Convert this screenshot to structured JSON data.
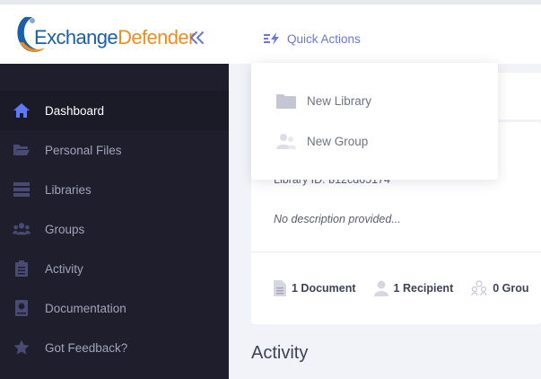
{
  "header": {
    "logo_part1": "Exchange",
    "logo_part2": "Defender",
    "quick_actions_label": "Quick Actions"
  },
  "dropdown": {
    "items": [
      {
        "label": "New Library",
        "icon": "folder-icon"
      },
      {
        "label": "New Group",
        "icon": "users-icon"
      }
    ]
  },
  "sidebar": {
    "items": [
      {
        "label": "Dashboard",
        "icon": "home-icon",
        "active": true
      },
      {
        "label": "Personal Files",
        "icon": "folder-open-icon"
      },
      {
        "label": "Libraries",
        "icon": "server-icon"
      },
      {
        "label": "Groups",
        "icon": "users-icon"
      },
      {
        "label": "Activity",
        "icon": "clipboard-icon"
      },
      {
        "label": "Documentation",
        "icon": "book-icon"
      },
      {
        "label": "Got Feedback?",
        "icon": "star-icon"
      }
    ]
  },
  "library_card": {
    "library_id": "Library ID: b12cd65174",
    "description": "No description provided...",
    "stats": {
      "documents": "1 Document",
      "recipients": "1 Recipient",
      "groups": "0 Grou"
    }
  },
  "activity": {
    "title": "Activity"
  },
  "colors": {
    "sidebar_bg": "#1e1e2d",
    "accent": "#6a77d9",
    "logo_blue": "#1b5fa8",
    "logo_orange": "#f28c1e"
  }
}
